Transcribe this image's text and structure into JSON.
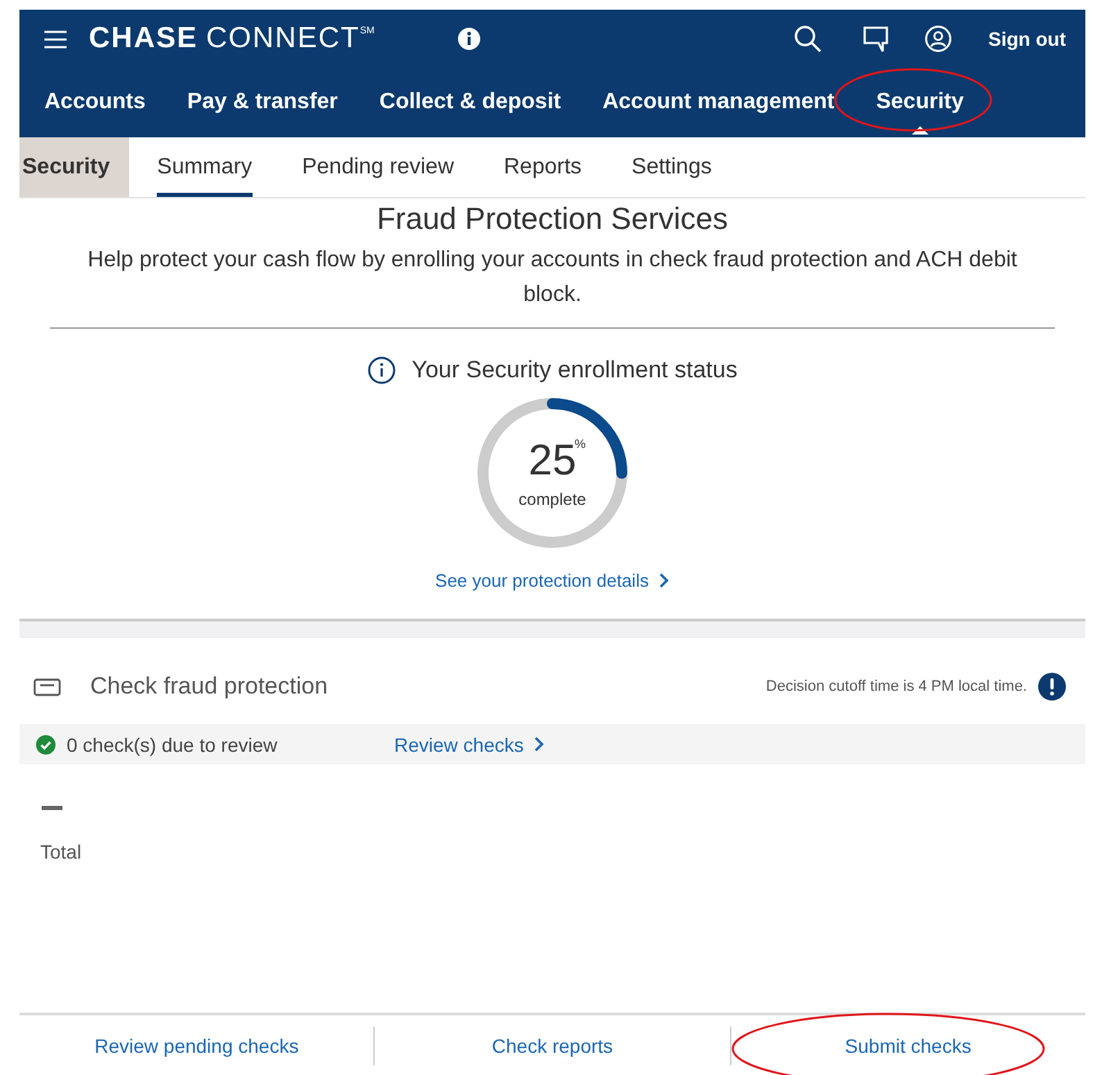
{
  "header": {
    "brand_bold": "CHASE",
    "brand_light": "CONNECT",
    "brand_mark": "SM",
    "sign_out": "Sign out"
  },
  "nav": [
    {
      "label": "Accounts",
      "selected": false,
      "circled": false
    },
    {
      "label": "Pay & transfer",
      "selected": false,
      "circled": false
    },
    {
      "label": "Collect & deposit",
      "selected": false,
      "circled": false
    },
    {
      "label": "Account management",
      "selected": false,
      "circled": false
    },
    {
      "label": "Security",
      "selected": true,
      "circled": true
    }
  ],
  "subnav": {
    "section": "Security",
    "tabs": [
      {
        "label": "Summary",
        "selected": true
      },
      {
        "label": "Pending review",
        "selected": false
      },
      {
        "label": "Reports",
        "selected": false
      },
      {
        "label": "Settings",
        "selected": false
      }
    ]
  },
  "fraud_services": {
    "title": "Fraud Protection Services",
    "description": "Help protect your cash flow by enrolling your accounts in check fraud protection and ACH debit block.",
    "status_title": "Your Security enrollment status",
    "percent": "25",
    "percent_sign": "%",
    "percent_caption": "complete",
    "level": 0.25,
    "link": "See your protection details"
  },
  "check_fraud": {
    "title": "Check fraud protection",
    "cutoff_note": "Decision cutoff time is 4 PM local time.",
    "review_status": "0 check(s) due to review",
    "review_link": "Review checks",
    "total_label": "Total"
  },
  "footer_links": [
    {
      "label": "Review pending checks",
      "circled": false
    },
    {
      "label": "Check reports",
      "circled": false
    },
    {
      "label": "Submit checks",
      "circled": true
    }
  ]
}
